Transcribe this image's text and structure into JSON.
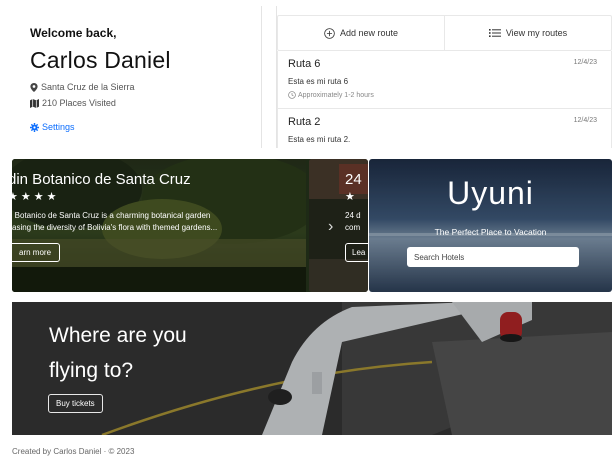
{
  "profile": {
    "welcome": "Welcome back,",
    "name": "Carlos Daniel",
    "location": "Santa Cruz de la Sierra",
    "places_visited": "210 Places Visited",
    "settings_label": "Settings"
  },
  "routes": {
    "add_label": "Add new route",
    "view_label": "View my routes",
    "items": [
      {
        "name": "Ruta 6",
        "date": "12/4/23",
        "description": "Esta es mi ruta 6",
        "duration": "Approximately 1-2 hours"
      },
      {
        "name": "Ruta 2",
        "date": "12/4/23",
        "description": "Esta es mi ruta 2."
      }
    ]
  },
  "carousel": {
    "slides": [
      {
        "title": "din Botanico de Santa Cruz",
        "stars": "★★★★",
        "desc_line1": "n Botanico de Santa Cruz is a charming botanical garden",
        "desc_line2": "casing the diversity of Bolivia's flora with themed gardens...",
        "button": "arn more"
      },
      {
        "title": "24",
        "stars": "★",
        "desc_line1": "24 d",
        "desc_line2": "com",
        "button": "Lea"
      }
    ],
    "next_icon": "chevron-right-icon"
  },
  "uyuni": {
    "title": "Uyuni",
    "subtitle": "The Perfect Place to Vacation",
    "search_placeholder": "Search Hotels"
  },
  "flight": {
    "title_line1": "Where are you",
    "title_line2": "flying to?",
    "button": "Buy tickets"
  },
  "footer": {
    "text": "Created by Carlos Daniel · © 2023"
  },
  "colors": {
    "link": "#0d6efd",
    "text": "#212529",
    "muted": "#777777"
  }
}
